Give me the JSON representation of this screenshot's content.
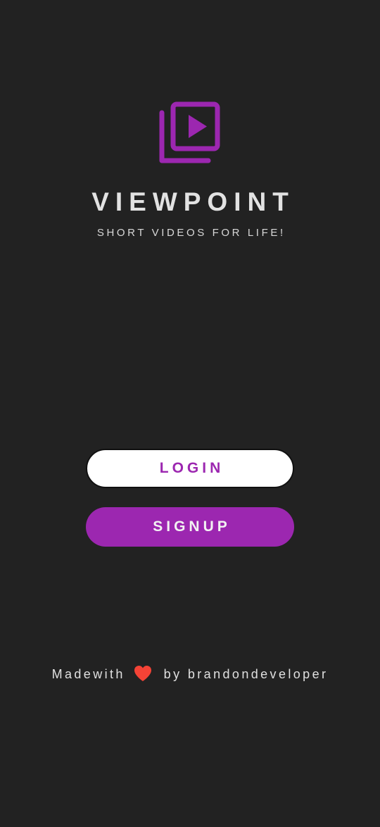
{
  "app": {
    "title": "VIEWPOINT",
    "tagline": "SHORT VIDEOS FOR LIFE!",
    "logo_icon": "video-library-icon"
  },
  "actions": {
    "login_label": "LOGIN",
    "signup_label": "SIGNUP"
  },
  "footer": {
    "prefix": "Madewith",
    "heart_icon": "heart-icon",
    "suffix": "by brandondeveloper"
  },
  "colors": {
    "background": "#222222",
    "accent": "#9c27b0",
    "heart": "#f44336",
    "text": "#e2e2e2"
  }
}
